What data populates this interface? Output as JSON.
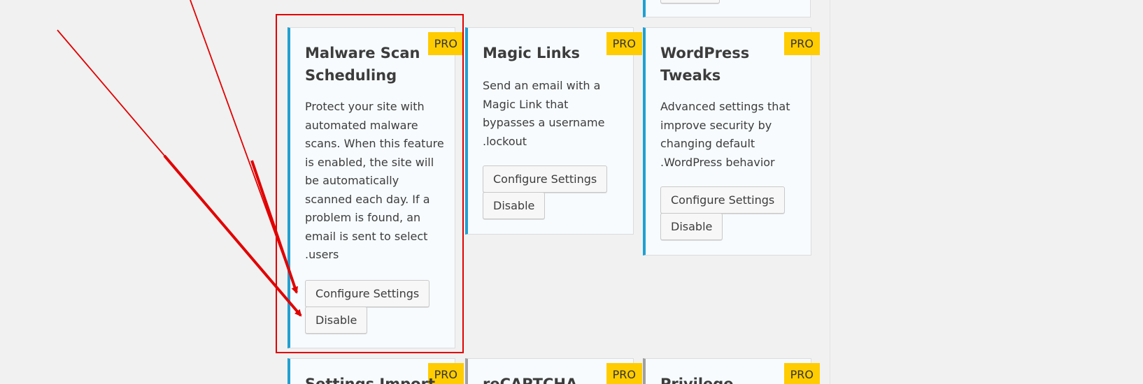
{
  "badge_label": "PRO",
  "cards": [
    {
      "title": "Malware Scan Scheduling",
      "description": "Protect your site with automated malware scans. When this feature is enabled, the site will be automatically scanned each day. If a problem is found, an email is sent to select .users",
      "configure_label": "Configure Settings",
      "disable_label": "Disable"
    },
    {
      "title": "Magic Links",
      "description": "Send an email with a Magic Link that bypasses a username .lockout",
      "configure_label": "Configure Settings",
      "disable_label": "Disable"
    },
    {
      "title": "WordPress Tweaks",
      "description": "Advanced settings that improve security by changing default .WordPress behavior",
      "configure_label": "Configure Settings",
      "disable_label": "Disable"
    }
  ],
  "bottom_cards": [
    {
      "title": "Settings Import"
    },
    {
      "title": "reCAPTCHA"
    },
    {
      "title": "Privilege"
    }
  ],
  "annotation_color": "#e10000",
  "accent_color": "#21a0d2",
  "badge_color": "#ffcc00"
}
